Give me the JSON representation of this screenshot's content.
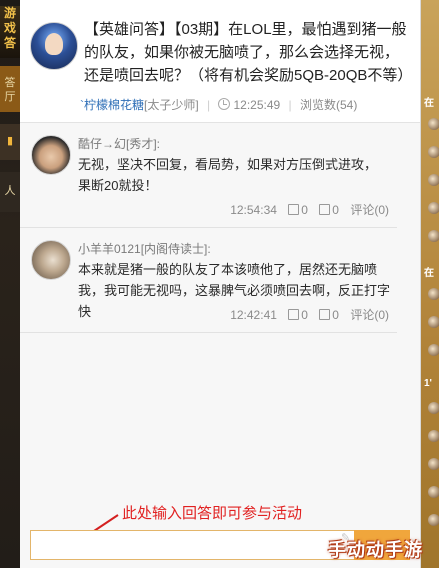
{
  "sidebar_left": {
    "logo_text": "游戏\n答",
    "tab1": "答\n厅",
    "tab2": "▮",
    "tab3": "人"
  },
  "question": {
    "title": "【英雄问答】【03期】在LOL里，最怕遇到猪一般的队友，如果你被无脑喷了，那么会选择无视，还是喷回去呢？（将有机会奖励5QB-20QB不等）",
    "user": "`柠檬棉花糖",
    "user_tag": "[太子少师]",
    "time": "12:25:49",
    "views": "浏览数(54)"
  },
  "answers": [
    {
      "name": "酷仔→幻[秀才]:",
      "text": "无视，坚决不回复，看局势，如果对方压倒式进攻， 果断20就投！",
      "time": "12:54:34",
      "likes": "0",
      "dislikes": "0",
      "comments": "评论(0)"
    },
    {
      "name": "小羊羊0121[内阁侍读士]:",
      "text": "本来就是猪一般的队友了本该喷他了，居然还无脑喷我，我可能无视吗，这暴脾气必须喷回去啊，反正打字快",
      "time": "12:42:41",
      "likes": "0",
      "dislikes": "0",
      "comments": "评论(0)"
    }
  ],
  "annotation": "此处输入回答即可参与活动",
  "right_strip": {
    "h1": "在",
    "h2": "在",
    "h3": "1'"
  },
  "watermark": "手动动手游",
  "colors": {
    "accent": "#f0a63c",
    "link": "#2f6fb7",
    "annotation": "#e12121"
  }
}
